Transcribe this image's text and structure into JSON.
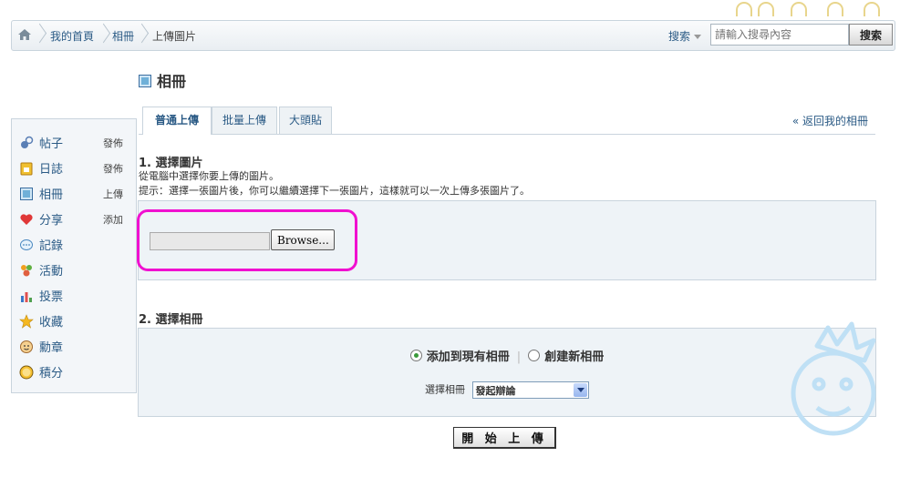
{
  "breadcrumb": {
    "items": [
      "我的首頁",
      "相冊",
      "上傳圖片"
    ]
  },
  "search": {
    "scope_label": "搜索",
    "placeholder": "請輸入搜尋內容",
    "button_label": "搜索"
  },
  "sidebar": {
    "items": [
      {
        "label": "帖子",
        "action": "發佈",
        "icon": "post-icon"
      },
      {
        "label": "日誌",
        "action": "發佈",
        "icon": "diary-icon"
      },
      {
        "label": "相冊",
        "action": "上傳",
        "icon": "album-icon"
      },
      {
        "label": "分享",
        "action": "添加",
        "icon": "share-heart-icon"
      },
      {
        "label": "記錄",
        "action": "",
        "icon": "record-bubble-icon"
      },
      {
        "label": "活動",
        "action": "",
        "icon": "activity-people-icon"
      },
      {
        "label": "投票",
        "action": "",
        "icon": "poll-bars-icon"
      },
      {
        "label": "收藏",
        "action": "",
        "icon": "star-icon"
      },
      {
        "label": "勳章",
        "action": "",
        "icon": "medal-face-icon"
      },
      {
        "label": "積分",
        "action": "",
        "icon": "fun-points-icon"
      }
    ]
  },
  "page": {
    "title": "相冊"
  },
  "tabs": [
    {
      "label": "普通上傳",
      "active": true
    },
    {
      "label": "批量上傳",
      "active": false
    },
    {
      "label": "大頭貼",
      "active": false
    }
  ],
  "back_link": "« 返回我的相冊",
  "section1": {
    "title": "1. 選擇圖片",
    "desc": "從電腦中選擇你要上傳的圖片。",
    "hint": "提示：選擇一張圖片後，你可以繼續選擇下一張圖片，這樣就可以一次上傳多張圖片了。",
    "browse_label": "Browse..."
  },
  "section2": {
    "title": "2. 選擇相冊",
    "option_existing": "添加到現有相冊",
    "option_new": "創建新相冊",
    "select_label": "選擇相冊",
    "select_value": "發起辯論"
  },
  "upload_button": "開 始 上 傳",
  "colors": {
    "link": "#2a5a85",
    "highlight": "#f010d0",
    "panel_bg": "#eef3f7",
    "border": "#c9d4dd"
  }
}
